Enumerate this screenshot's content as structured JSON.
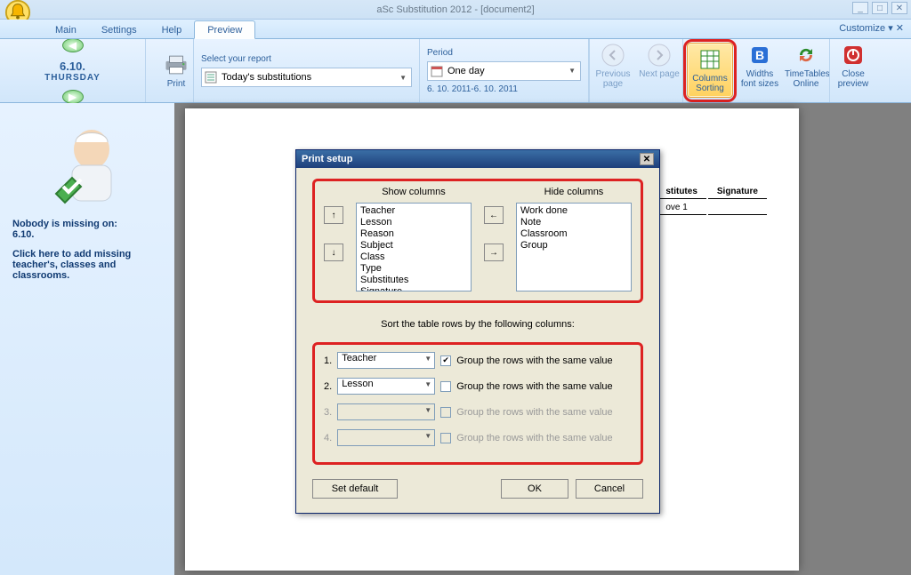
{
  "app": {
    "title": "aSc Substitution 2012  - [document2]",
    "customize": "Customize ▾ ✕"
  },
  "tabs": {
    "main": "Main",
    "settings": "Settings",
    "help": "Help",
    "preview": "Preview"
  },
  "ribbon": {
    "date": "6.10.",
    "dow": "THURSDAY",
    "print": "Print",
    "report_label": "Select your report",
    "report_value": "Today's substitutions",
    "period_label": "Period",
    "period_value": "One day",
    "period_range": "6. 10. 2011-6. 10. 2011",
    "prev_page": "Previous page",
    "next_page": "Next page",
    "columns_sorting": "Columns Sorting",
    "widths": "Widths font sizes",
    "timetables": "TimeTables Online",
    "close_preview": "Close preview"
  },
  "sidebar": {
    "line1": "Nobody is missing on:",
    "line2": "6.10.",
    "line3": "Click here to add missing teacher's, classes and classrooms."
  },
  "paper": {
    "hdr1": "stitutes",
    "hdr2": "Signature",
    "row1": "ove 1"
  },
  "dialog": {
    "title": "Print setup",
    "show_label": "Show columns",
    "hide_label": "Hide columns",
    "show_items": [
      "Teacher",
      "Lesson",
      "Reason",
      "Subject",
      "Class",
      "Type",
      "Substitutes",
      "Signature"
    ],
    "hide_items": [
      "Work done",
      "Note",
      "Classroom",
      "Group"
    ],
    "sort_instruction": "Sort the table rows by the following columns:",
    "rows": [
      {
        "n": "1.",
        "val": "Teacher",
        "chk": true,
        "enabled": true
      },
      {
        "n": "2.",
        "val": "Lesson",
        "chk": false,
        "enabled": true
      },
      {
        "n": "3.",
        "val": "",
        "chk": false,
        "enabled": false
      },
      {
        "n": "4.",
        "val": "",
        "chk": false,
        "enabled": false
      }
    ],
    "group_label": "Group the rows with the same value",
    "set_default": "Set default",
    "ok": "OK",
    "cancel": "Cancel"
  }
}
